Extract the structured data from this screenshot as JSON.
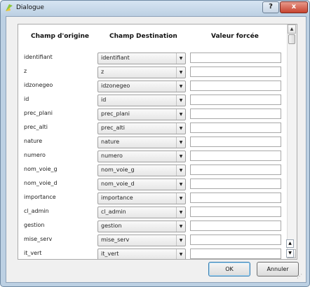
{
  "window": {
    "title": "Dialogue",
    "help_label": "?",
    "close_label": "x"
  },
  "headers": {
    "origin": "Champ d'origine",
    "destination": "Champ Destination",
    "forced": "Valeur forcée"
  },
  "rows": [
    {
      "origin": "identifiant",
      "destination": "identifiant",
      "forced": ""
    },
    {
      "origin": "z",
      "destination": "z",
      "forced": ""
    },
    {
      "origin": "idzonegeo",
      "destination": "idzonegeo",
      "forced": ""
    },
    {
      "origin": "id",
      "destination": "id",
      "forced": ""
    },
    {
      "origin": "prec_plani",
      "destination": "prec_plani",
      "forced": ""
    },
    {
      "origin": "prec_alti",
      "destination": "prec_alti",
      "forced": ""
    },
    {
      "origin": "nature",
      "destination": "nature",
      "forced": ""
    },
    {
      "origin": "numero",
      "destination": "numero",
      "forced": ""
    },
    {
      "origin": "nom_voie_g",
      "destination": "nom_voie_g",
      "forced": ""
    },
    {
      "origin": "nom_voie_d",
      "destination": "nom_voie_d",
      "forced": ""
    },
    {
      "origin": "importance",
      "destination": "importance",
      "forced": ""
    },
    {
      "origin": "cl_admin",
      "destination": "cl_admin",
      "forced": ""
    },
    {
      "origin": "gestion",
      "destination": "gestion",
      "forced": ""
    },
    {
      "origin": "mise_serv",
      "destination": "mise_serv",
      "forced": ""
    },
    {
      "origin": "it_vert",
      "destination": "it_vert",
      "forced": ""
    }
  ],
  "buttons": {
    "ok": "OK",
    "cancel": "Annuler"
  },
  "icons": {
    "app": "qgis-logo-icon",
    "combo_arrow": "chevron-down-icon",
    "scroll_up": "arrow-up-icon",
    "scroll_down": "arrow-down-icon",
    "size_grip": "resize-grip-icon"
  }
}
